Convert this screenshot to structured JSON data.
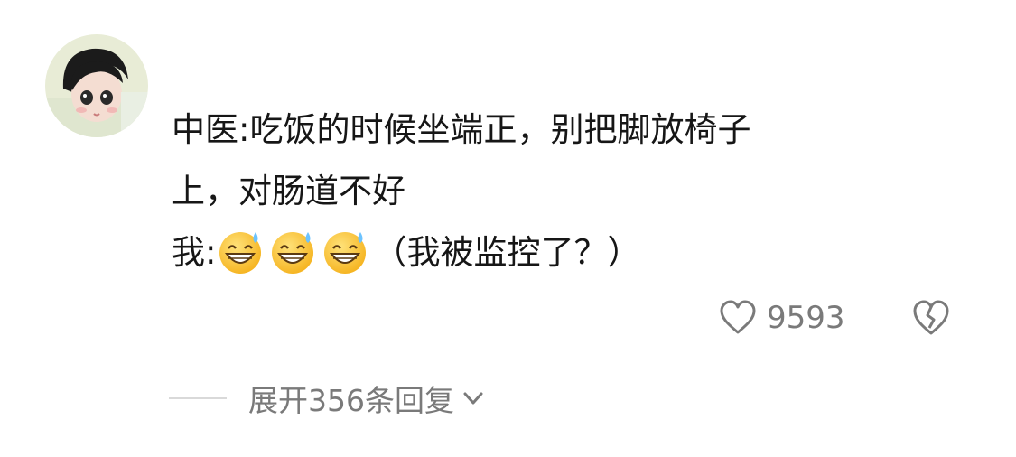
{
  "comment": {
    "line1": "中医:吃饭的时候坐端正，别把脚放椅子",
    "line2": "上，对肠道不好",
    "line3_prefix": "我:",
    "line3_suffix": "（我被监控了？）",
    "emoji_name": "grinning-sweat-emoji",
    "emoji_count": 3
  },
  "actions": {
    "like_count": "9593"
  },
  "replies": {
    "expand_label": "展开356条回复"
  },
  "icons": {
    "like": "heart-outline-icon",
    "dislike": "broken-heart-icon",
    "expand": "chevron-down-icon"
  },
  "colors": {
    "text": "#161616",
    "muted": "#7a7a7a"
  }
}
